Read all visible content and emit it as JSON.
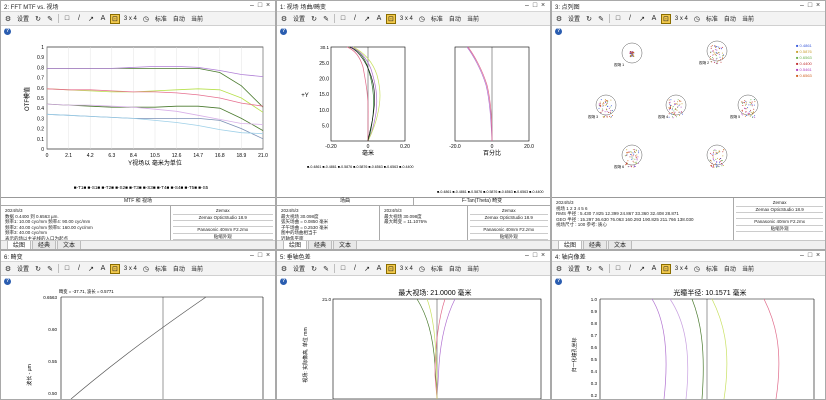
{
  "toolbar": {
    "settings": "设置",
    "layout": "3 x 4",
    "standard": "标准",
    "auto": "自动",
    "current": "当前"
  },
  "tabs": {
    "graph": "绘图",
    "classic": "经典",
    "text": "文本"
  },
  "windows": {
    "w1": {
      "title": "2: FFT MTF vs. 视场",
      "ylabel": "OTF模值",
      "xlabel": "Y视场以 毫米为单位",
      "yticks": [
        "1",
        "0.9",
        "0.8",
        "0.7",
        "0.6",
        "0.5",
        "0.4",
        "0.3",
        "0.2",
        "0.1",
        "0"
      ],
      "xticks": [
        "0",
        "2.1",
        "4.2",
        "6.3",
        "8.4",
        "10.5",
        "12.6",
        "14.7",
        "16.8",
        "18.9",
        "21.0"
      ],
      "legend": "■-T1■ ■-S1■ ■-T2■ ■-S2■ ■-T3■ ■-S3■ ■-T4■ ■-S4■ ■-T5■ ■-S5",
      "info_head": "MTF 和 视场",
      "info_left": [
        "2024/5/3",
        "数据 0.4400 到 0.6563 µm.",
        "频率1: 10.00 cyc/mm  频率4: 90.00 cyc/mm",
        "频率2: 40.00 cyc/mm  频率5: 160.00 cyc/mm",
        "频率3: 40.00 cyc/mm",
        "表示的场以主光线的入口为起点",
        "图例中的项目指的是于空间频率(X)极限"
      ],
      "info_right": [
        "Zemax",
        "Zemax OpticStudio 18.9",
        "",
        "Panasonic 40mm F2.zmx",
        "贴缩外观"
      ],
      "mtf_data": [
        {
          "name": "T1",
          "color": "#4a7a2e",
          "values": [
            0.79,
            0.79,
            0.79,
            0.79,
            0.79,
            0.79,
            0.79,
            0.79,
            0.75,
            0.62,
            0.41
          ]
        },
        {
          "name": "S1",
          "color": "#b07fd6",
          "values": [
            0.79,
            0.79,
            0.79,
            0.79,
            0.8,
            0.81,
            0.81,
            0.8,
            0.77,
            0.73,
            0.71
          ]
        },
        {
          "name": "T2",
          "color": "#b6e04a",
          "values": [
            0.59,
            0.58,
            0.57,
            0.56,
            0.56,
            0.57,
            0.58,
            0.59,
            0.58,
            0.5,
            0.36
          ]
        },
        {
          "name": "S2",
          "color": "#e66f8f",
          "values": [
            0.59,
            0.58,
            0.58,
            0.57,
            0.56,
            0.56,
            0.55,
            0.53,
            0.5,
            0.45,
            0.42
          ]
        },
        {
          "name": "T3",
          "color": "#4a7a2e",
          "values": [
            0.44,
            0.43,
            0.42,
            0.41,
            0.41,
            0.41,
            0.42,
            0.42,
            0.4,
            0.3,
            0.18
          ]
        },
        {
          "name": "S3",
          "color": "#d8b0e8",
          "values": [
            0.44,
            0.43,
            0.43,
            0.42,
            0.41,
            0.39,
            0.37,
            0.33,
            0.29,
            0.25,
            0.24
          ]
        },
        {
          "name": "T4",
          "color": "#7a8fb5",
          "values": [
            0.34,
            0.33,
            0.32,
            0.31,
            0.3,
            0.3,
            0.3,
            0.3,
            0.28,
            0.2,
            0.1
          ]
        },
        {
          "name": "S4",
          "color": "#9fd0e8",
          "values": [
            0.34,
            0.33,
            0.32,
            0.31,
            0.3,
            0.28,
            0.26,
            0.23,
            0.19,
            0.16,
            0.15
          ]
        }
      ]
    },
    "w2": {
      "title": "1: 视场 场曲/畸变",
      "xlabel_left": "毫米",
      "xlabel_right": "百分比",
      "ylabel": "+Y",
      "ytop": "30.1",
      "yticks": [
        "25.0",
        "20.0",
        "15.0",
        "10.0",
        "5.0"
      ],
      "xticks_left": [
        "-0.20",
        "0",
        "0.20"
      ],
      "xticks_right": [
        "-20.0",
        "0",
        "20.0"
      ],
      "legend1": "■-0.4861 ■-0.4861 ■-0.5876 ■-0.5876 ■-0.6563 ■-0.6563 ■-0.4400",
      "legend2": "■-0.4861 ■-0.4861 ■-0.5876 ■-0.5876 ■-0.6563 ■-0.6563 ■-0.4400",
      "info_head1": "场曲",
      "info_head2": "F-Tan(Theta) 畸变",
      "info_left": [
        "2024/5/3",
        "最大视场 30.098度",
        "弧矢场曲 = 0.0850 毫米",
        "子午场曲 = 0.2530 毫米",
        "图中的场曲相当于",
        "近轴焦平面"
      ],
      "info_mid": [
        "2024/5/3",
        "最大视场 30.098度",
        "最大畸变 = 11.1076%"
      ],
      "info_right": [
        "Zemax",
        "Zemax OpticStudio 18.9",
        "",
        "Panasonic 40mm F2.zmx",
        "贴缩外观"
      ]
    },
    "w3": {
      "title": "3: 点列图",
      "legend": [
        "0.4861",
        "0.5876",
        "0.6563",
        "0.4400",
        "0.5461",
        "0.6563"
      ],
      "legend_colors": [
        "#3b5bdb",
        "#c8a030",
        "#6ab04c",
        "#c03030",
        "#b040c0",
        "#d06020"
      ],
      "spot_labels": [
        "视场 1",
        "视场 2",
        "视场 3",
        "视场 4",
        "视场 5",
        "视场 6"
      ],
      "info_rows": [
        "2024/5/3",
        "视场          1        2        3        4        5        6",
        "RMS 半径 :  5.430    7.825   12.399   24.867   33.360   32.408   28.871",
        "GEO 半径 :  15.297   36.630   76.063   160.293  190.825  211.766  138.030",
        "视场尺寸 :  100    参考: 质心"
      ],
      "info_right": [
        "Zemax",
        "Zemax OpticStudio 18.9",
        "",
        "Panasonic 40mm F2.zmx",
        "贴缩外观"
      ]
    },
    "w4": {
      "title": "6: 畸变",
      "top_label": "畸变 = -37.71, 波长 = 0.5771",
      "ylabel": "波长 - µm",
      "yticks": [
        "0.6563",
        "0.60",
        "0.55",
        "0.50"
      ]
    },
    "w5": {
      "title": "5: 垂轴色差",
      "header": "最大视场: 21.0000 毫米",
      "ylabel": "视场: 实际像高, 单位 mm",
      "ytop": "21.0"
    },
    "w6": {
      "title": "4: 轴向像差",
      "header": "光瞳半径: 10.1571 毫米",
      "ylabel": "归一化瞳孔坐标",
      "yticks": [
        "1.0",
        "0.9",
        "0.8",
        "0.7",
        "0.6",
        "0.5",
        "0.4",
        "0.3",
        "0.2"
      ]
    }
  }
}
